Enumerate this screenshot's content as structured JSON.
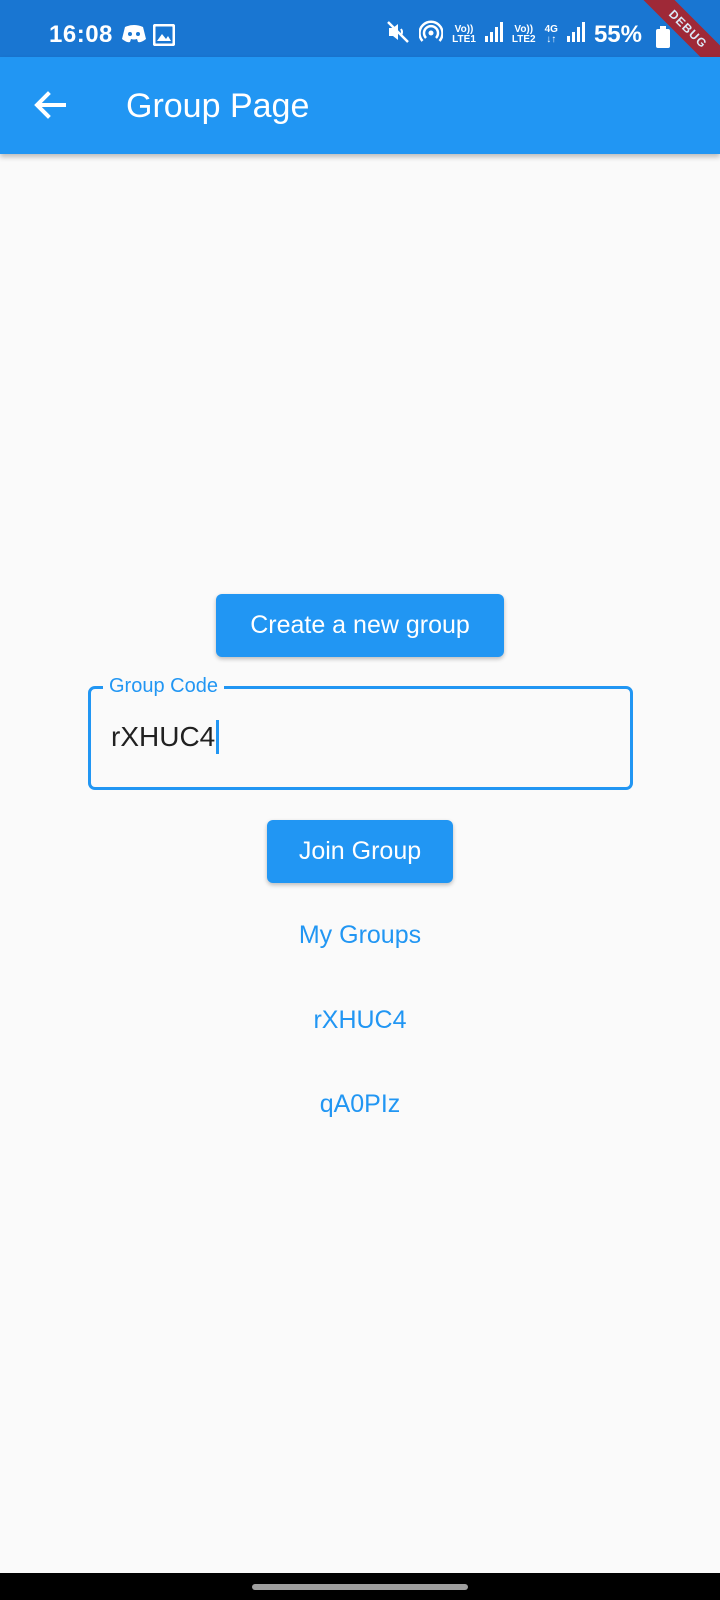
{
  "status_bar": {
    "time": "16:08",
    "sim1_label_top": "Vo))",
    "sim1_label_bottom": "LTE1",
    "sim2_label_top": "Vo))",
    "sim2_label_bottom": "LTE2",
    "data_label_top": "4G",
    "data_label_bottom": "↓↑",
    "battery": "55%",
    "icons": [
      "discord-icon",
      "gallery-icon",
      "mute-icon",
      "hotspot-icon",
      "signal-icon",
      "signal-icon",
      "battery-icon"
    ]
  },
  "debug_banner": "DEBUG",
  "app_bar": {
    "title": "Group Page",
    "back_icon": "arrow-back-icon"
  },
  "main": {
    "create_button_label": "Create a new group",
    "group_code_field": {
      "label": "Group Code",
      "value": "rXHUC4"
    },
    "join_button_label": "Join Group",
    "my_groups_label": "My Groups",
    "groups": [
      "rXHUC4",
      "qA0PIz"
    ]
  },
  "colors": {
    "status_bar": "#1976d2",
    "app_bar": "#2196f3",
    "accent": "#2196f3",
    "background": "#fafafa",
    "debug": "#b71c1c"
  }
}
